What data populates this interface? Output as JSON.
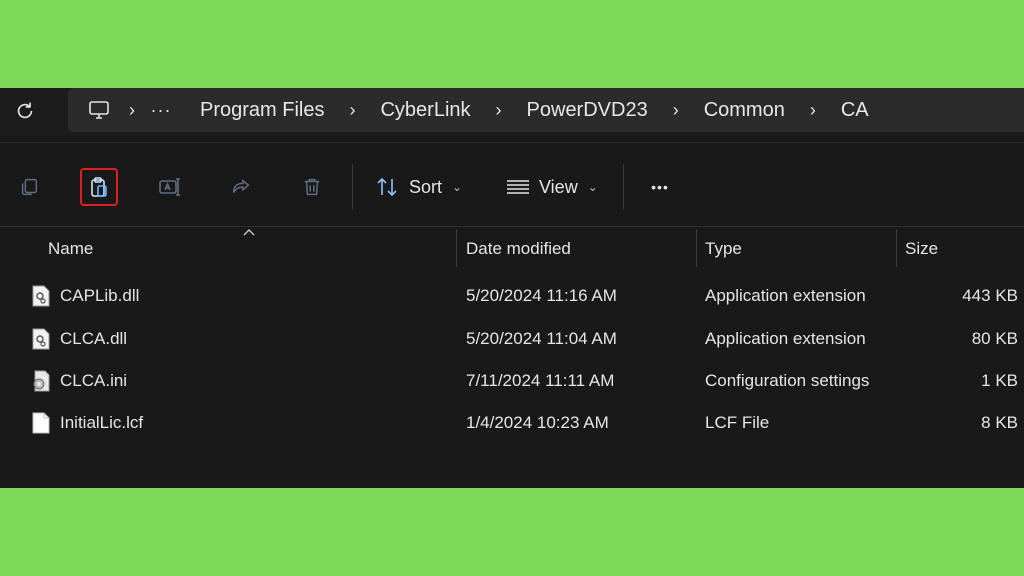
{
  "address": {
    "path": [
      "Program Files",
      "CyberLink",
      "PowerDVD23",
      "Common",
      "CA"
    ],
    "overflow_label": "···",
    "separator": "›"
  },
  "toolbar": {
    "sort_label": "Sort",
    "view_label": "View",
    "more_label": "•••"
  },
  "columns": {
    "name": "Name",
    "date": "Date modified",
    "type": "Type",
    "size": "Size"
  },
  "files": [
    {
      "name": "CAPLib.dll",
      "date": "5/20/2024 11:16 AM",
      "type": "Application extension",
      "size": "443 KB",
      "icon": "dll-file-icon"
    },
    {
      "name": "CLCA.dll",
      "date": "5/20/2024 11:04 AM",
      "type": "Application extension",
      "size": "80 KB",
      "icon": "dll-file-icon"
    },
    {
      "name": "CLCA.ini",
      "date": "7/11/2024 11:11 AM",
      "type": "Configuration settings",
      "size": "1 KB",
      "icon": "settings-file-icon"
    },
    {
      "name": "InitialLic.lcf",
      "date": "1/4/2024 10:23 AM",
      "type": "LCF File",
      "size": "8 KB",
      "icon": "blank-file-icon"
    }
  ],
  "colors": {
    "background_green": "#7ed957",
    "window": "#191919",
    "highlight_border": "#e02020"
  }
}
